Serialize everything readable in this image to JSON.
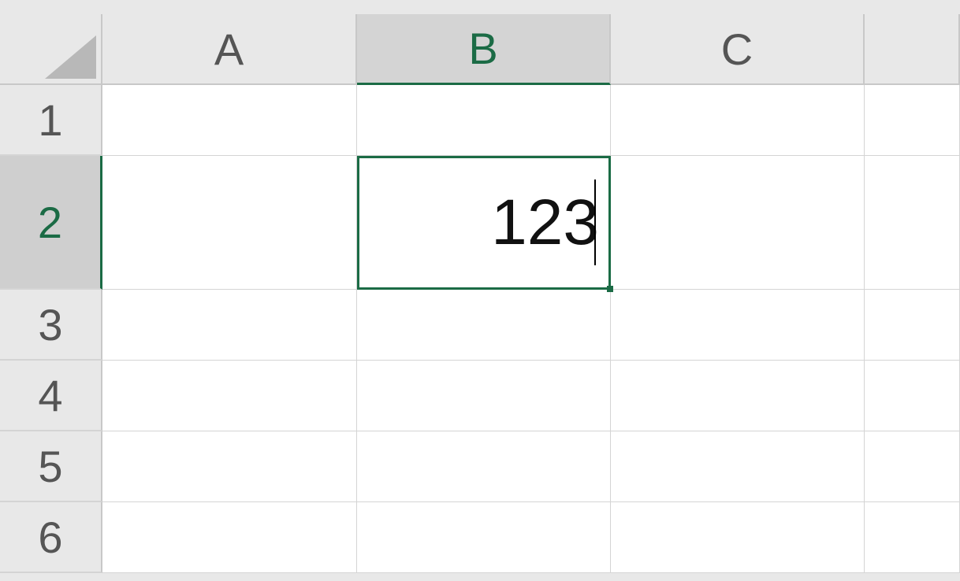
{
  "columns": [
    "A",
    "B",
    "C"
  ],
  "rows": [
    "1",
    "2",
    "3",
    "4",
    "5",
    "6"
  ],
  "active_cell": "B2",
  "active_column": "B",
  "active_row": "2",
  "cells": {
    "B2": "123"
  }
}
